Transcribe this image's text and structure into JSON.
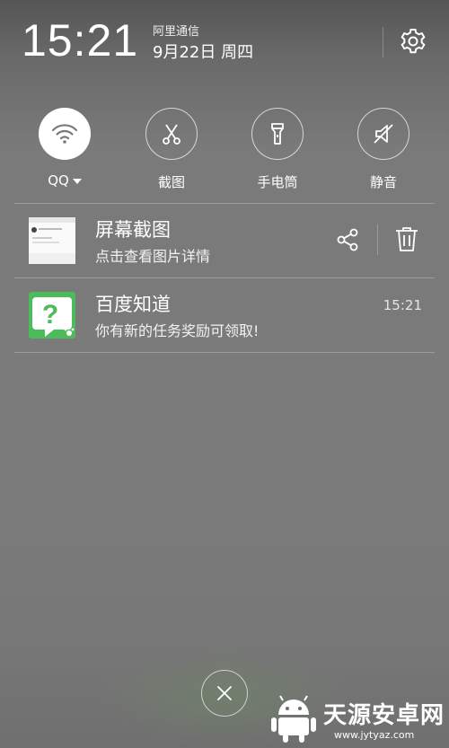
{
  "status": {
    "time": "15:21",
    "carrier": "阿里通信",
    "date": "9月22日 周四"
  },
  "icons": {
    "settings": "gear-icon",
    "wifi": "wifi-icon",
    "screenshot": "scissors-icon",
    "flashlight": "flashlight-icon",
    "mute": "speaker-muted-icon",
    "share": "share-icon",
    "delete": "trash-icon",
    "close": "close-icon"
  },
  "quick_settings": [
    {
      "label": "QQ",
      "active": true
    },
    {
      "label": "截图",
      "active": false
    },
    {
      "label": "手电筒",
      "active": false
    },
    {
      "label": "静音",
      "active": false
    }
  ],
  "notifications": [
    {
      "title": "屏幕截图",
      "body": "点击查看图片详情",
      "time": ""
    },
    {
      "title": "百度知道",
      "body": "你有新的任务奖励可领取!",
      "time": "15:21"
    }
  ],
  "watermark": {
    "name": "天源安卓网",
    "url": "www.jytyaz.com"
  },
  "colors": {
    "accent_green": "#4cbb5a",
    "background": "#7a7a7a",
    "wifi_icon": "#7a7a7a"
  }
}
